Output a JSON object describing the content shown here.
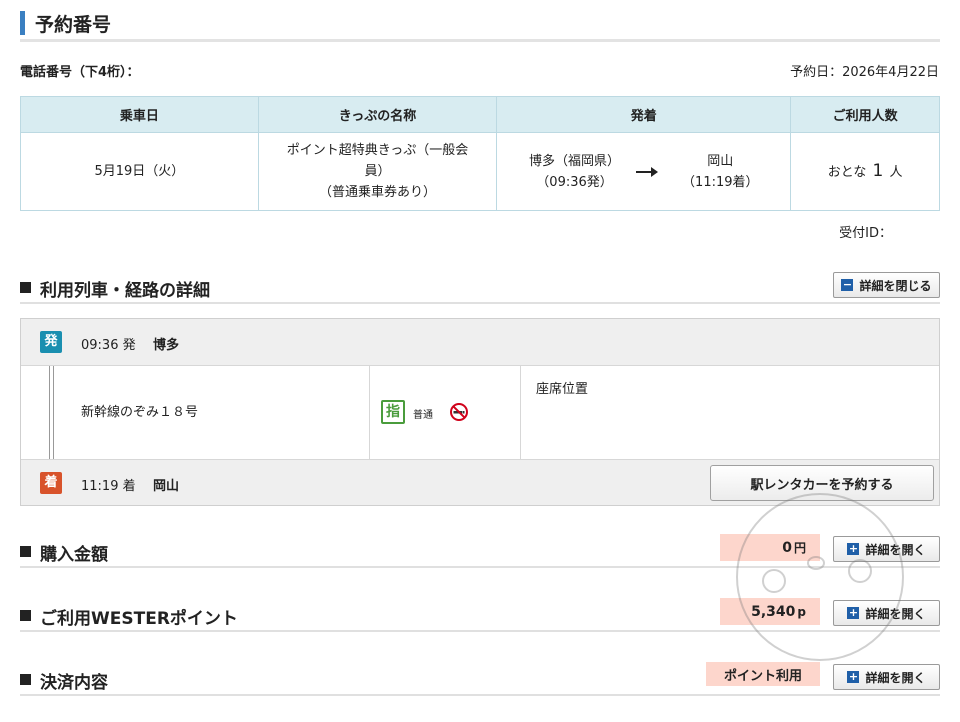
{
  "header": {
    "title": "予約番号"
  },
  "phone": {
    "label": "電話番号（下4桁）："
  },
  "booking": {
    "date_label": "予約日：2026年4月22日"
  },
  "summary_table": {
    "headers": [
      "乗車日",
      "きっぷの名称",
      "発着",
      "ご利用人数"
    ],
    "ride_date": "5月19日（火）",
    "ticket_name_line1": "ポイント超特典きっぷ（一般会",
    "ticket_name_line2": "員）",
    "ticket_name_line3": "（普通乗車券あり）",
    "from_station": "博多（福岡県）",
    "from_time": "（09:36発）",
    "to_station": "岡山",
    "to_time": "（11:19着）",
    "passengers_prefix": "おとな",
    "passengers_count": "1",
    "passengers_suffix": "人"
  },
  "reception": {
    "label": "受付ID："
  },
  "route_section": {
    "title": "利用列車・経路の詳細",
    "close_button": "詳細を閉じる",
    "close_icon": "minus-icon",
    "departure": {
      "badge": "発",
      "time": "09:36 発",
      "station": "博多"
    },
    "train": {
      "name": "新幹線のぞみ１８号",
      "reserved_badge": "指",
      "car_type": "普通",
      "smoking": "no-smoking-icon",
      "seat_label": "座席位置"
    },
    "arrival": {
      "badge": "着",
      "time": "11:19 着",
      "station": "岡山"
    },
    "rental_button": "駅レンタカーを予約する"
  },
  "purchase_section": {
    "title": "購入金額",
    "amount": "0",
    "unit": "円",
    "open_button": "詳細を開く",
    "open_icon": "plus-icon"
  },
  "points_section": {
    "title": "ご利用WESTERポイント",
    "amount": "5,340",
    "unit": "p",
    "open_button": "詳細を開く",
    "open_icon": "plus-icon"
  },
  "payment_section": {
    "title": "決済内容",
    "label": "ポイント利用",
    "open_button": "詳細を開く",
    "open_icon": "plus-icon"
  },
  "colors": {
    "accent": "#3a7fc1",
    "table_header": "#d8ecf1",
    "badge_departure": "#1a8fb0",
    "badge_arrival": "#d8532b",
    "reserved": "#4a9c3c",
    "highlight": "#fdd6cc",
    "button_icon": "#1f5fa8"
  }
}
